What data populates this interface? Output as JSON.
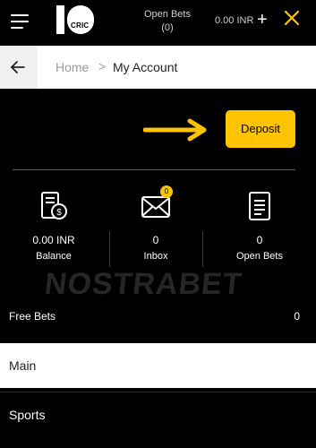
{
  "header": {
    "open_bets_label": "Open Bets",
    "open_bets_count": "(0)",
    "balance": "0.00 INR",
    "logo_text": "CRIC",
    "accent_color": "#ffc400"
  },
  "breadcrumb": {
    "home": "Home",
    "separator": ">",
    "current": "My Account"
  },
  "account": {
    "deposit_label": "Deposit",
    "stats": [
      {
        "value": "0.00 INR",
        "label": "Balance",
        "icon": "wallet-coin-icon"
      },
      {
        "value": "0",
        "label": "Inbox",
        "icon": "mail-icon",
        "badge": "0"
      },
      {
        "value": "0",
        "label": "Open Bets",
        "icon": "betslip-icon"
      }
    ],
    "watermark": "NOSTRABET",
    "free_bets_label": "Free Bets",
    "free_bets_value": "0"
  },
  "menu": {
    "main": "Main",
    "sports": "Sports"
  }
}
